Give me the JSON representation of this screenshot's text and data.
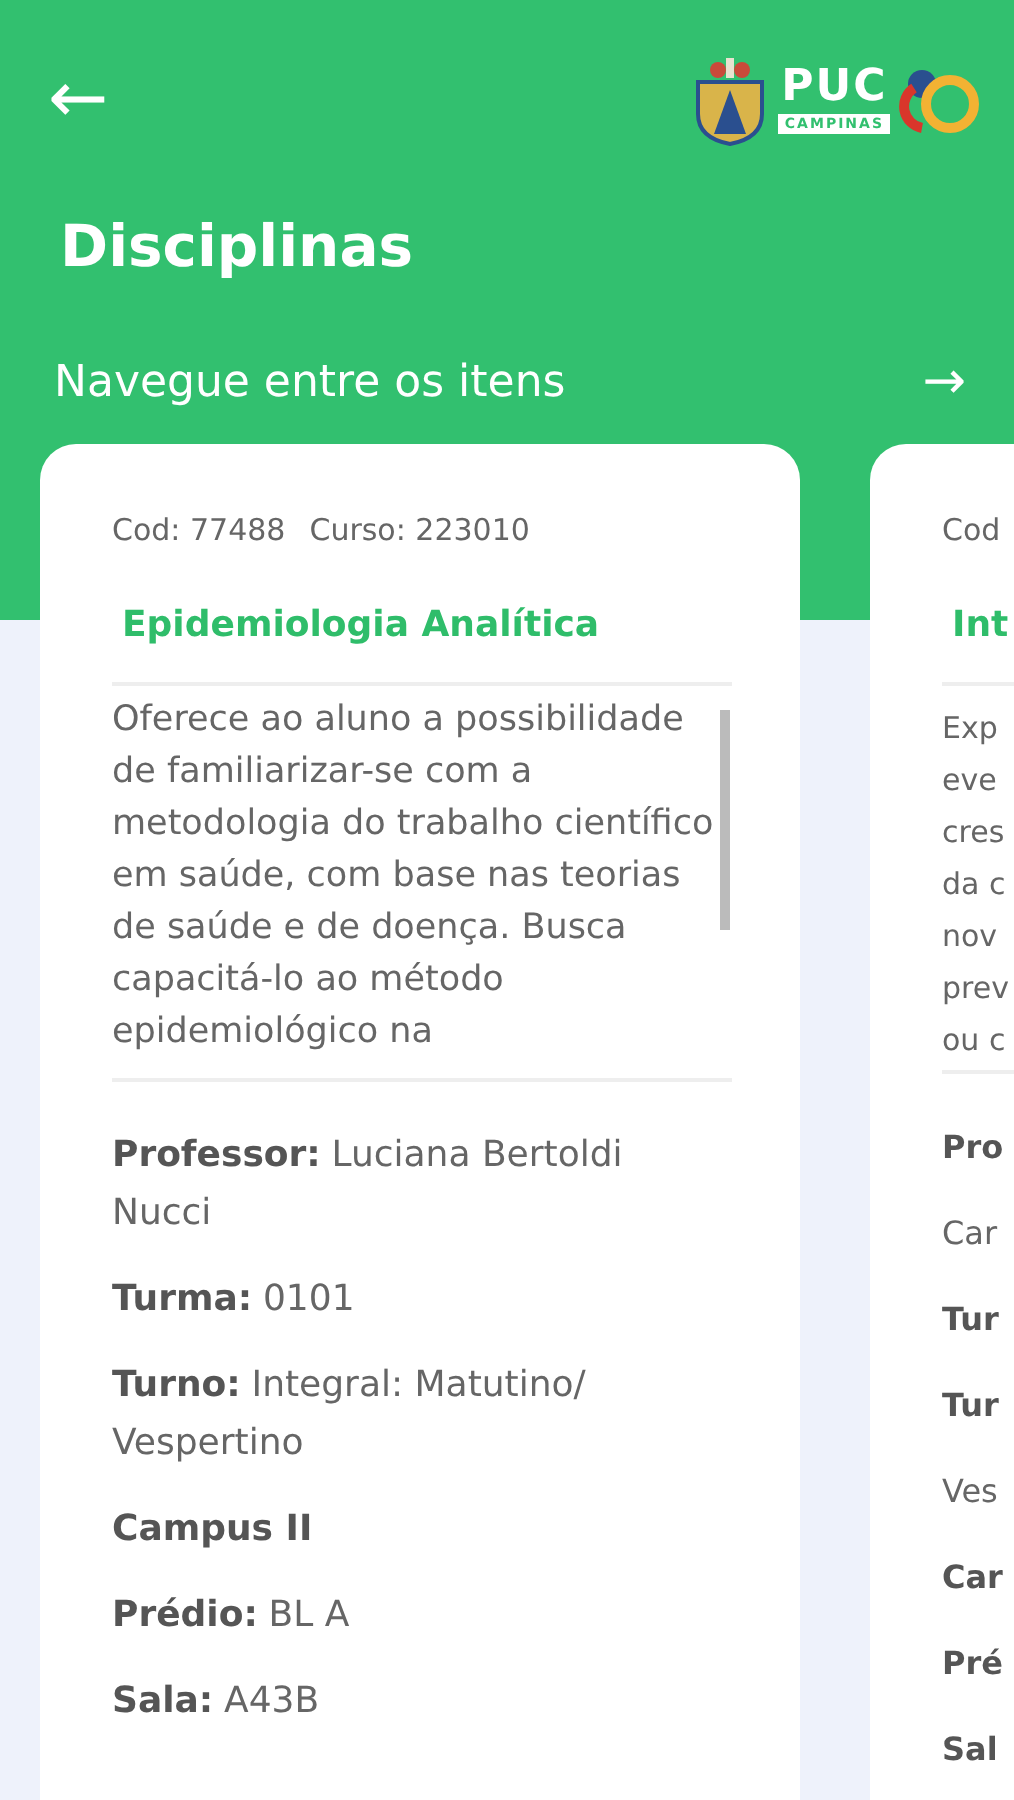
{
  "header": {
    "back": "←",
    "logo": {
      "name": "PUC",
      "subtitle": "CAMPINAS"
    },
    "title": "Disciplinas",
    "subtitle": "Navegue entre os itens",
    "next": "→"
  },
  "cards": [
    {
      "cod": "Cod: 77488",
      "curso": "Curso: 223010",
      "title": "Epidemiologia Analítica",
      "description": "Oferece ao aluno a possibilidade de familiarizar-se com a metodologia do trabalho científico em saúde, com base nas teorias de saúde e de doença. Busca capacitá-lo ao método epidemiológico na",
      "fields": [
        {
          "label": "Professor:",
          "value": "Luciana Bertoldi Nucci"
        },
        {
          "label": "Turma:",
          "value": "0101"
        },
        {
          "label": "Turno:",
          "value": "Integral: Matutino/ Vespertino"
        },
        {
          "label": "Campus II"
        },
        {
          "label": "Prédio:",
          "value": "BL A"
        },
        {
          "label": "Sala:",
          "value": "A43B"
        }
      ]
    },
    {
      "cod": "Cod",
      "title": "Int",
      "description_lines": [
        "Exp",
        "eve",
        "cres",
        "da c",
        "nov",
        "prev",
        "ou c"
      ],
      "field_lines": [
        {
          "text": "Pro",
          "bold": true
        },
        {
          "text": "Car",
          "bold": false
        },
        {
          "text": "Tur",
          "bold": true
        },
        {
          "text": "Tur",
          "bold": true
        },
        {
          "text": "Ves",
          "bold": false
        },
        {
          "text": "Car",
          "bold": true
        },
        {
          "text": "Pré",
          "bold": true
        },
        {
          "text": "Sal",
          "bold": true
        }
      ]
    }
  ]
}
